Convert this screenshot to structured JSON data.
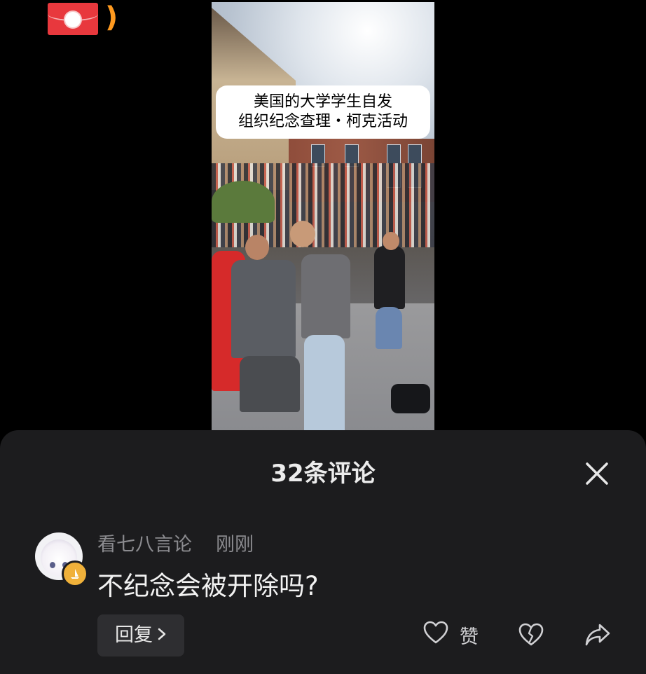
{
  "video": {
    "caption_line1": "美国的大学学生自发",
    "caption_line2": "组织纪念查理・柯克活动"
  },
  "comments_sheet": {
    "title": "32条评论",
    "comment": {
      "username": "看七八言论",
      "time": "刚刚",
      "text": "不纪念会被开除吗?",
      "reply_label": "回复",
      "like_label": "赞"
    }
  },
  "icons": {
    "top_left": "red-envelope-icon",
    "close": "close-icon",
    "chevron": "chevron-right-icon",
    "like": "heart-outline-icon",
    "dislike": "broken-heart-icon",
    "share": "share-arrow-icon",
    "badge": "sailboat-badge-icon"
  },
  "colors": {
    "sheet_bg": "#1c1c1e",
    "badge": "#f0b13a",
    "envelope": "#e8383d",
    "paren": "#ff9a1f"
  }
}
